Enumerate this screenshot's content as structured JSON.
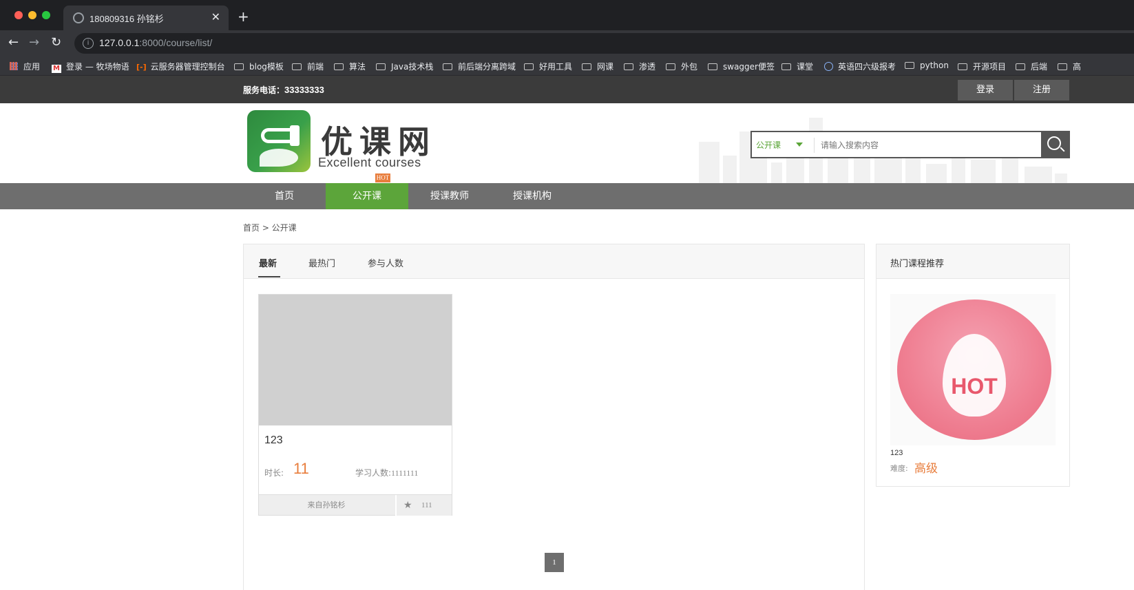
{
  "browser": {
    "tab_title": "180809316 孙铭杉",
    "url_host": "127.0.0.1",
    "url_rest": ":8000/course/list/",
    "bookmarks": [
      "应用",
      "登录 — 牧场物语",
      "云服务器管理控制台",
      "blog模板",
      "前端",
      "算法",
      "Java技术栈",
      "前后端分离跨域",
      "好用工具",
      "网课",
      "渗透",
      "外包",
      "swagger便签",
      "课堂",
      "英语四六级报考",
      "python",
      "开源项目",
      "后端",
      "高"
    ]
  },
  "topbar": {
    "phone_label": "服务电话：",
    "phone_number": "33333333",
    "login": "登录",
    "register": "注册"
  },
  "brand": {
    "name_cn": "优课网",
    "name_en": "Excellent courses",
    "hot": "HOT"
  },
  "search": {
    "category": "公开课",
    "placeholder": "请输入搜索内容"
  },
  "nav": [
    "首页",
    "公开课",
    "授课教师",
    "授课机构"
  ],
  "breadcrumb": "首页 > 公开课",
  "sort": [
    "最新",
    "最热门",
    "参与人数"
  ],
  "course": {
    "title": "123",
    "duration_label": "时长:",
    "duration": "11",
    "students_label": "学习人数:",
    "students": "1111111",
    "from": "来自孙铭杉",
    "favs": "111"
  },
  "pagination": {
    "current": "1"
  },
  "side": {
    "title": "热门课程推荐",
    "badge": "HOT",
    "course_name": "123",
    "difficulty_label": "难度:",
    "difficulty": "高级"
  }
}
